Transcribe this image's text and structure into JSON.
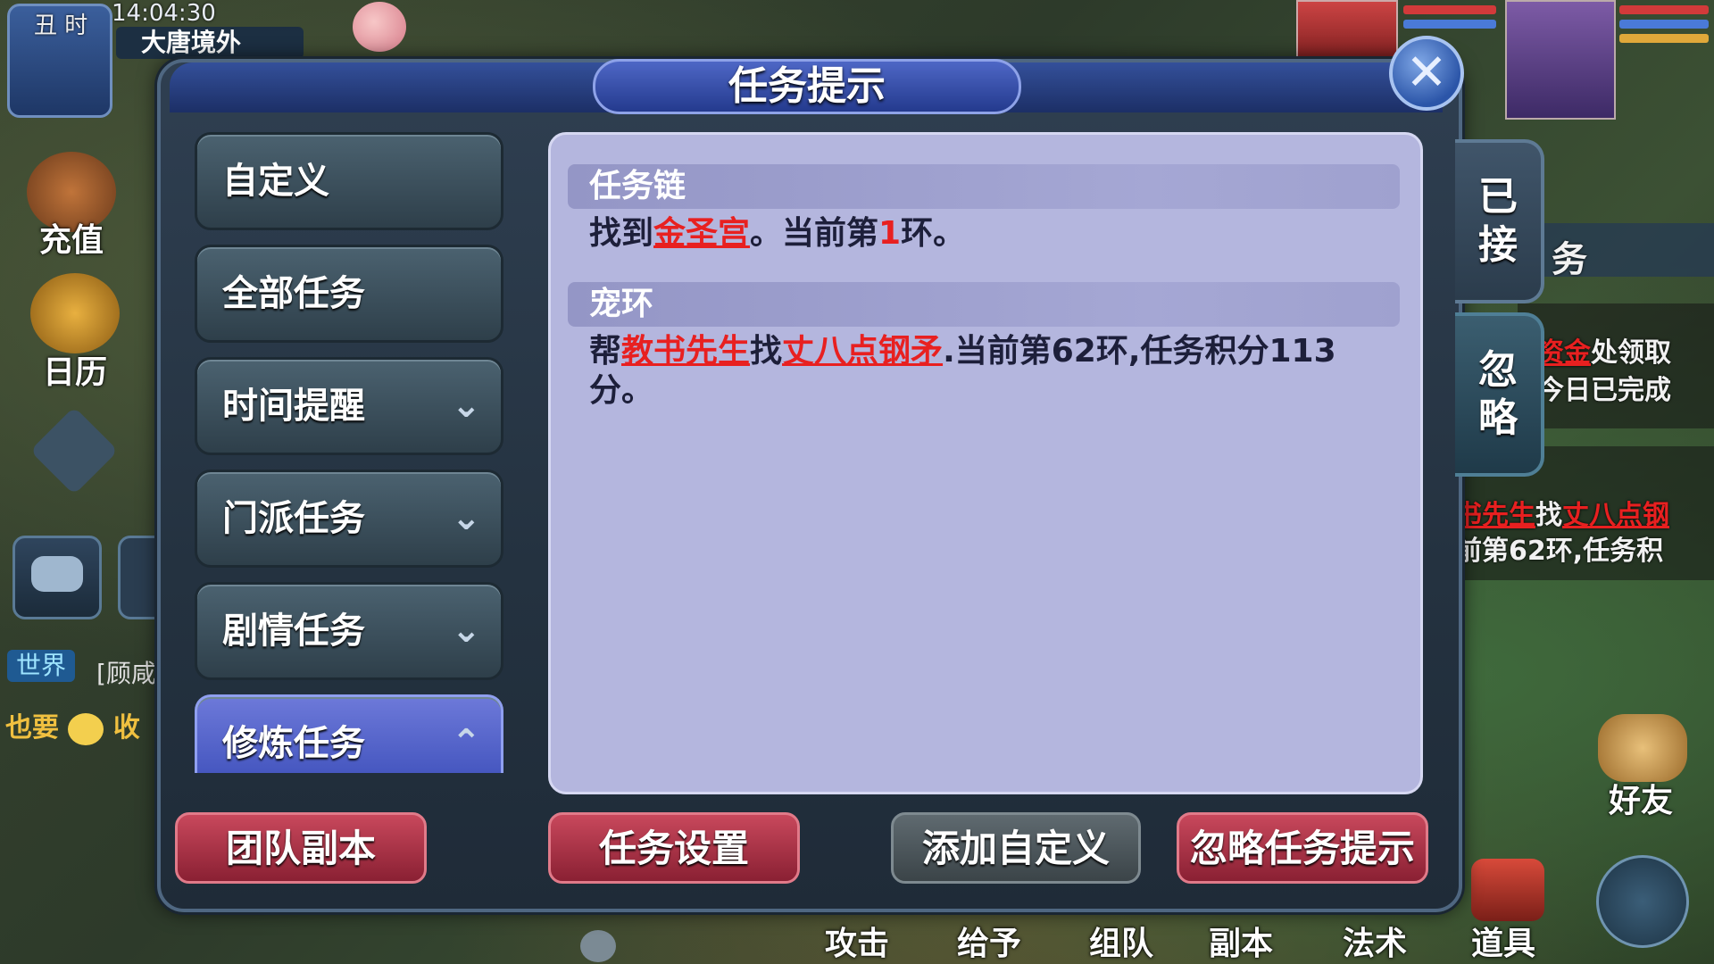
{
  "hud": {
    "shichen": "丑 时",
    "time": "14:04:30",
    "map_name": "大唐境外"
  },
  "left_side": {
    "recharge_label": "充值",
    "calendar_label": "日历",
    "chat_channel": "世界",
    "chat_text": "[顾咸",
    "chat_line2_prefix": "也要",
    "chat_line2_suffix": "收"
  },
  "dialog": {
    "title": "任务提示",
    "close_symbol": "✕",
    "categories": [
      {
        "label": "自定义",
        "expandable": false
      },
      {
        "label": "全部任务",
        "expandable": false
      },
      {
        "label": "时间提醒",
        "expandable": true,
        "chevron": "⌄"
      },
      {
        "label": "门派任务",
        "expandable": true,
        "chevron": "⌄"
      },
      {
        "label": "剧情任务",
        "expandable": true,
        "chevron": "⌄"
      },
      {
        "label": "修炼任务",
        "expandable": true,
        "chevron": "⌃",
        "active": true
      }
    ],
    "tasks": [
      {
        "title": "任务链",
        "p1": "找到",
        "link1": "金圣宫",
        "p2": "。当前第",
        "num": "1",
        "p3": "环。"
      },
      {
        "title": "宠环",
        "p1": "帮",
        "link1": "教书先生",
        "p2": "找",
        "link2": "丈八点钢矛",
        "p3": ".当前第62环,任务积分113",
        "p4": "分。"
      }
    ],
    "side_tabs": {
      "accepted_1": "已",
      "accepted_2": "接",
      "ignore_1": "忽",
      "ignore_2": "略"
    },
    "buttons": {
      "team_dungeon": "团队副本",
      "task_settings": "任务设置",
      "add_custom": "添加自定义",
      "ignore_hint": "忽略任务提示"
    }
  },
  "right_side": {
    "line1_link": "资金",
    "line1_text": "处领取",
    "line2": "今日已完成",
    "line3_link1": "书先生",
    "line3_mid": "找",
    "line3_link2": "丈八点钢",
    "line4": "前第62环,任务积",
    "friends_label": "好友",
    "tab_partial": "务"
  },
  "toolbar": {
    "attack": "攻击",
    "give": "给予",
    "team": "组队",
    "dungeon": "副本",
    "magic": "法术",
    "items": "道具"
  },
  "colors": {
    "accent_red": "#e82020",
    "panel_bg": "#b4b6de",
    "button_red": "#a73246",
    "active_tab": "#5a68cc"
  }
}
